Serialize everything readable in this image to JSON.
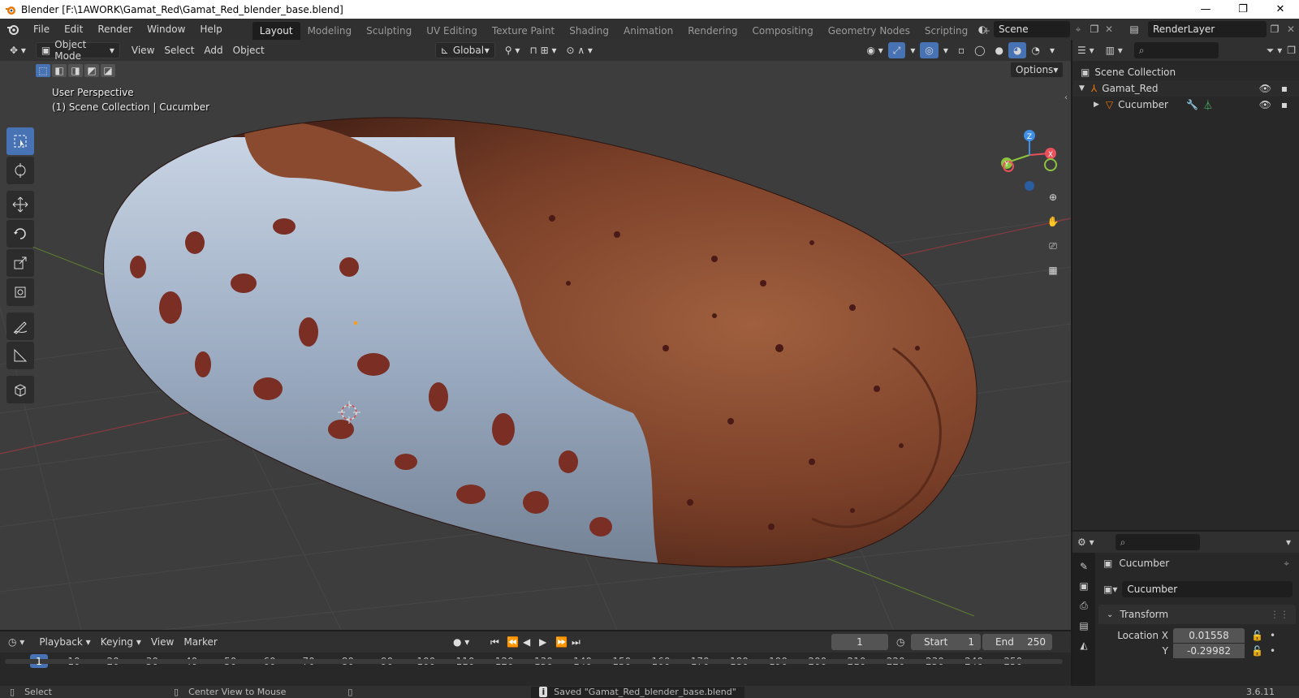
{
  "window": {
    "title": "Blender [F:\\1AWORK\\Gamat_Red\\Gamat_Red_blender_base.blend]",
    "minimize": "—",
    "maximize": "❐",
    "close": "✕"
  },
  "menu": [
    "File",
    "Edit",
    "Render",
    "Window",
    "Help"
  ],
  "workspace_tabs": [
    "Layout",
    "Modeling",
    "Sculpting",
    "UV Editing",
    "Texture Paint",
    "Shading",
    "Animation",
    "Rendering",
    "Compositing",
    "Geometry Nodes",
    "Scripting"
  ],
  "workspace_add": "+",
  "scene_name": "Scene",
  "render_layer": "RenderLayer",
  "viewport": {
    "mode": "Object Mode",
    "menus": [
      "View",
      "Select",
      "Add",
      "Object"
    ],
    "orientation": "Global",
    "options_label": "Options",
    "perspective_label": "User Perspective",
    "collection_label": "(1) Scene Collection | Cucumber",
    "gizmo": {
      "x": "X",
      "y": "Y",
      "z": "Z"
    }
  },
  "outliner": {
    "root": "Scene Collection",
    "items": [
      {
        "name": "Gamat_Red"
      },
      {
        "name": "Cucumber"
      }
    ]
  },
  "properties": {
    "object_name": "Cucumber",
    "data_name": "Cucumber",
    "section": "Transform",
    "location_x_label": "Location X",
    "location_x": "0.01558",
    "location_y_label": "Y",
    "location_y": "-0.29982"
  },
  "timeline": {
    "menus": [
      "Playback",
      "Keying",
      "View",
      "Marker"
    ],
    "current_frame": "1",
    "start_label": "Start",
    "start": "1",
    "end_label": "End",
    "end": "250",
    "ticks": [
      "1",
      "10",
      "20",
      "30",
      "40",
      "50",
      "60",
      "70",
      "80",
      "90",
      "100",
      "110",
      "120",
      "130",
      "140",
      "150",
      "160",
      "170",
      "180",
      "190",
      "200",
      "210",
      "220",
      "230",
      "240",
      "250"
    ]
  },
  "status": {
    "select": "Select",
    "center_view": "Center View to Mouse",
    "message": "Saved \"Gamat_Red_blender_base.blend\"",
    "version": "3.6.11"
  },
  "colors": {
    "accent": "#4772b3",
    "axis_x": "#e8515b",
    "axis_y": "#8dc43f",
    "axis_z": "#3f8fe8",
    "header": "#303030",
    "viewport": "#3d3d3d"
  }
}
